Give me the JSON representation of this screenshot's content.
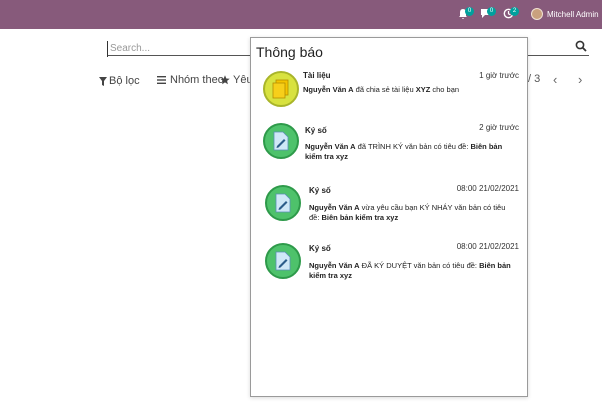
{
  "topbar": {
    "bg_color": "#875a7b",
    "icons": [
      {
        "name": "bell-icon",
        "badge": "0"
      },
      {
        "name": "chat-icon",
        "badge": "0"
      },
      {
        "name": "clock-icon",
        "badge": "2"
      }
    ],
    "user_name": "Mitchell Admin"
  },
  "search": {
    "placeholder": "Search..."
  },
  "filters": {
    "filter_label": "Bộ lọc",
    "group_label": "Nhóm theo",
    "favorite_label": "Yêu"
  },
  "pager": {
    "text": "/ 3"
  },
  "notifications": {
    "title": "Thông báo",
    "items": [
      {
        "category": "Tài liệu",
        "time": "1 giờ trước",
        "actor": "Nguyễn Văn A",
        "text1": " đã chia sẻ tài liệu ",
        "subject": "XYZ",
        "text2": " cho bạn",
        "icon": "document-icon",
        "circle_color": "#d8e23f"
      },
      {
        "category": "Ký số",
        "time": "2 giờ trước",
        "actor": "Nguyễn Văn A",
        "text1": " đã TRÌNH KÝ văn bản có tiêu đề: ",
        "subject": "Biên bản kiểm tra xyz",
        "text2": "",
        "icon": "sign-document-icon",
        "circle_color": "#4ec26b"
      },
      {
        "category": "Ký số",
        "time": "08:00  21/02/2021",
        "actor": "Nguyễn Văn A",
        "text1": " vừa yêu cầu bạn KÝ NHÁY văn bản có tiêu đề: ",
        "subject": "Biên bản kiểm tra xyz",
        "text2": "",
        "icon": "sign-document-icon",
        "circle_color": "#4ec26b"
      },
      {
        "category": "Ký số",
        "time": "08:00  21/02/2021",
        "actor": "Nguyễn Văn A",
        "text1": " ĐÃ KÝ DUYỆT văn bản có tiêu đề: ",
        "subject": "Biên bản kiểm tra xyz",
        "text2": "",
        "icon": "sign-document-icon",
        "circle_color": "#4ec26b"
      }
    ]
  }
}
